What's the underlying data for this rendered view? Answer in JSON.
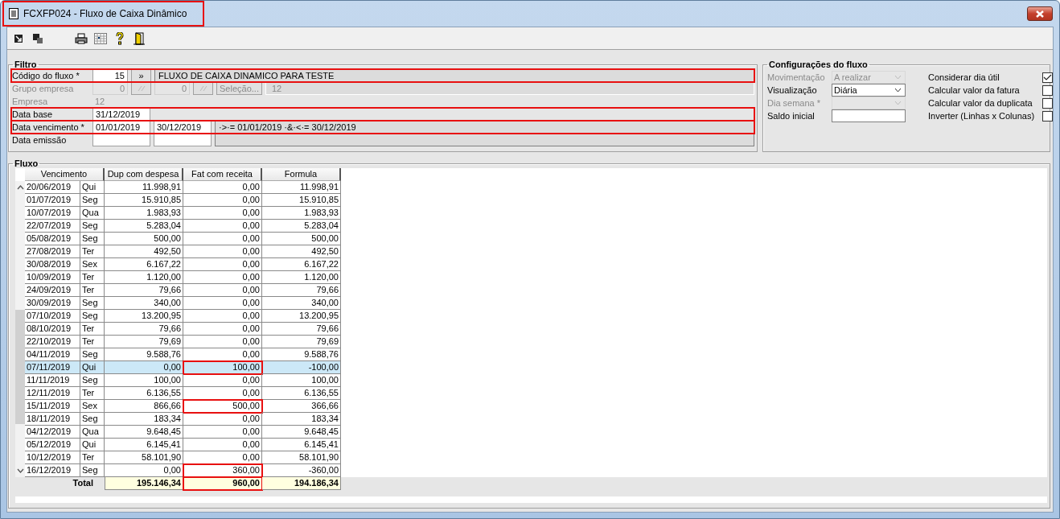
{
  "window": {
    "title": "FCXFP024 - Fluxo de Caixa Dinâmico",
    "title_marked": true
  },
  "filter": {
    "title": "Filtro",
    "rows": [
      {
        "kind": "code",
        "label": "Código do fluxo *",
        "disabled": false,
        "marked": true,
        "value": "15",
        "button": "»",
        "description": "FLUXO DE CAIXA DINAMICO PARA TESTE"
      },
      {
        "kind": "group",
        "label": "Grupo empresa",
        "disabled": true,
        "marked": false,
        "value": "0",
        "value_2": "0",
        "button": "Seleção...",
        "count": "12"
      },
      {
        "kind": "text",
        "label": "Empresa",
        "disabled": true,
        "marked": false,
        "value": "12"
      },
      {
        "kind": "date",
        "label": "Data base",
        "disabled": false,
        "marked": true,
        "value": "31/12/2019"
      },
      {
        "kind": "range",
        "label": "Data vencimento *",
        "disabled": false,
        "marked": true,
        "value": "01/01/2019",
        "value_2": "30/12/2019",
        "expression": "·>·= 01/01/2019 ·&·<·= 30/12/2019"
      },
      {
        "kind": "range",
        "label": "Data emissão",
        "disabled": false,
        "marked": false
      }
    ]
  },
  "settings": {
    "title": "Configurações do fluxo",
    "fields": [
      {
        "kind": "select",
        "label": "Movimentação",
        "disabled": true,
        "value": "A realizar"
      },
      {
        "kind": "select",
        "label": "Visualização",
        "disabled": false,
        "value": "Diária"
      },
      {
        "kind": "select",
        "label": "Dia semana *",
        "disabled": true
      },
      {
        "kind": "input",
        "label": "Saldo inicial",
        "disabled": false
      }
    ],
    "options": [
      {
        "label": "Considerar dia útil",
        "checked": true
      },
      {
        "label": "Calcular valor da fatura",
        "checked": false
      },
      {
        "label": "Calcular valor da duplicata",
        "checked": false
      },
      {
        "label": "Inverter (Linhas x Colunas)",
        "checked": false
      }
    ]
  },
  "flow": {
    "title": "Fluxo",
    "columns": [
      "Vencimento",
      "Dup com despesa",
      "Fat com receita",
      "Formula"
    ],
    "rows": [
      {
        "date": "20/06/2019",
        "day": "Qui",
        "dup": "11.998,91",
        "fat": "0,00",
        "formula": "11.998,91",
        "selected": false,
        "fat_marked": false
      },
      {
        "date": "01/07/2019",
        "day": "Seg",
        "dup": "15.910,85",
        "fat": "0,00",
        "formula": "15.910,85",
        "selected": false,
        "fat_marked": false
      },
      {
        "date": "10/07/2019",
        "day": "Qua",
        "dup": "1.983,93",
        "fat": "0,00",
        "formula": "1.983,93",
        "selected": false,
        "fat_marked": false
      },
      {
        "date": "22/07/2019",
        "day": "Seg",
        "dup": "5.283,04",
        "fat": "0,00",
        "formula": "5.283,04",
        "selected": false,
        "fat_marked": false
      },
      {
        "date": "05/08/2019",
        "day": "Seg",
        "dup": "500,00",
        "fat": "0,00",
        "formula": "500,00",
        "selected": false,
        "fat_marked": false
      },
      {
        "date": "27/08/2019",
        "day": "Ter",
        "dup": "492,50",
        "fat": "0,00",
        "formula": "492,50",
        "selected": false,
        "fat_marked": false
      },
      {
        "date": "30/08/2019",
        "day": "Sex",
        "dup": "6.167,22",
        "fat": "0,00",
        "formula": "6.167,22",
        "selected": false,
        "fat_marked": false
      },
      {
        "date": "10/09/2019",
        "day": "Ter",
        "dup": "1.120,00",
        "fat": "0,00",
        "formula": "1.120,00",
        "selected": false,
        "fat_marked": false
      },
      {
        "date": "24/09/2019",
        "day": "Ter",
        "dup": "79,66",
        "fat": "0,00",
        "formula": "79,66",
        "selected": false,
        "fat_marked": false
      },
      {
        "date": "30/09/2019",
        "day": "Seg",
        "dup": "340,00",
        "fat": "0,00",
        "formula": "340,00",
        "selected": false,
        "fat_marked": false
      },
      {
        "date": "07/10/2019",
        "day": "Seg",
        "dup": "13.200,95",
        "fat": "0,00",
        "formula": "13.200,95",
        "selected": false,
        "fat_marked": false
      },
      {
        "date": "08/10/2019",
        "day": "Ter",
        "dup": "79,66",
        "fat": "0,00",
        "formula": "79,66",
        "selected": false,
        "fat_marked": false
      },
      {
        "date": "22/10/2019",
        "day": "Ter",
        "dup": "79,69",
        "fat": "0,00",
        "formula": "79,69",
        "selected": false,
        "fat_marked": false
      },
      {
        "date": "04/11/2019",
        "day": "Seg",
        "dup": "9.588,76",
        "fat": "0,00",
        "formula": "9.588,76",
        "selected": false,
        "fat_marked": false
      },
      {
        "date": "07/11/2019",
        "day": "Qui",
        "dup": "0,00",
        "fat": "100,00",
        "formula": "-100,00",
        "selected": true,
        "fat_marked": true
      },
      {
        "date": "11/11/2019",
        "day": "Seg",
        "dup": "100,00",
        "fat": "0,00",
        "formula": "100,00",
        "selected": false,
        "fat_marked": false
      },
      {
        "date": "12/11/2019",
        "day": "Ter",
        "dup": "6.136,55",
        "fat": "0,00",
        "formula": "6.136,55",
        "selected": false,
        "fat_marked": false
      },
      {
        "date": "15/11/2019",
        "day": "Sex",
        "dup": "866,66",
        "fat": "500,00",
        "formula": "366,66",
        "selected": false,
        "fat_marked": true
      },
      {
        "date": "18/11/2019",
        "day": "Seg",
        "dup": "183,34",
        "fat": "0,00",
        "formula": "183,34",
        "selected": false,
        "fat_marked": false
      },
      {
        "date": "04/12/2019",
        "day": "Qua",
        "dup": "9.648,45",
        "fat": "0,00",
        "formula": "9.648,45",
        "selected": false,
        "fat_marked": false
      },
      {
        "date": "05/12/2019",
        "day": "Qui",
        "dup": "6.145,41",
        "fat": "0,00",
        "formula": "6.145,41",
        "selected": false,
        "fat_marked": false
      },
      {
        "date": "10/12/2019",
        "day": "Ter",
        "dup": "58.101,90",
        "fat": "0,00",
        "formula": "58.101,90",
        "selected": false,
        "fat_marked": false
      },
      {
        "date": "16/12/2019",
        "day": "Seg",
        "dup": "0,00",
        "fat": "360,00",
        "formula": "-360,00",
        "selected": false,
        "fat_marked": true
      }
    ],
    "total": {
      "label": "Total",
      "dup": "195.146,34",
      "fat": "960,00",
      "formula": "194.186,34",
      "fat_marked": true
    }
  }
}
